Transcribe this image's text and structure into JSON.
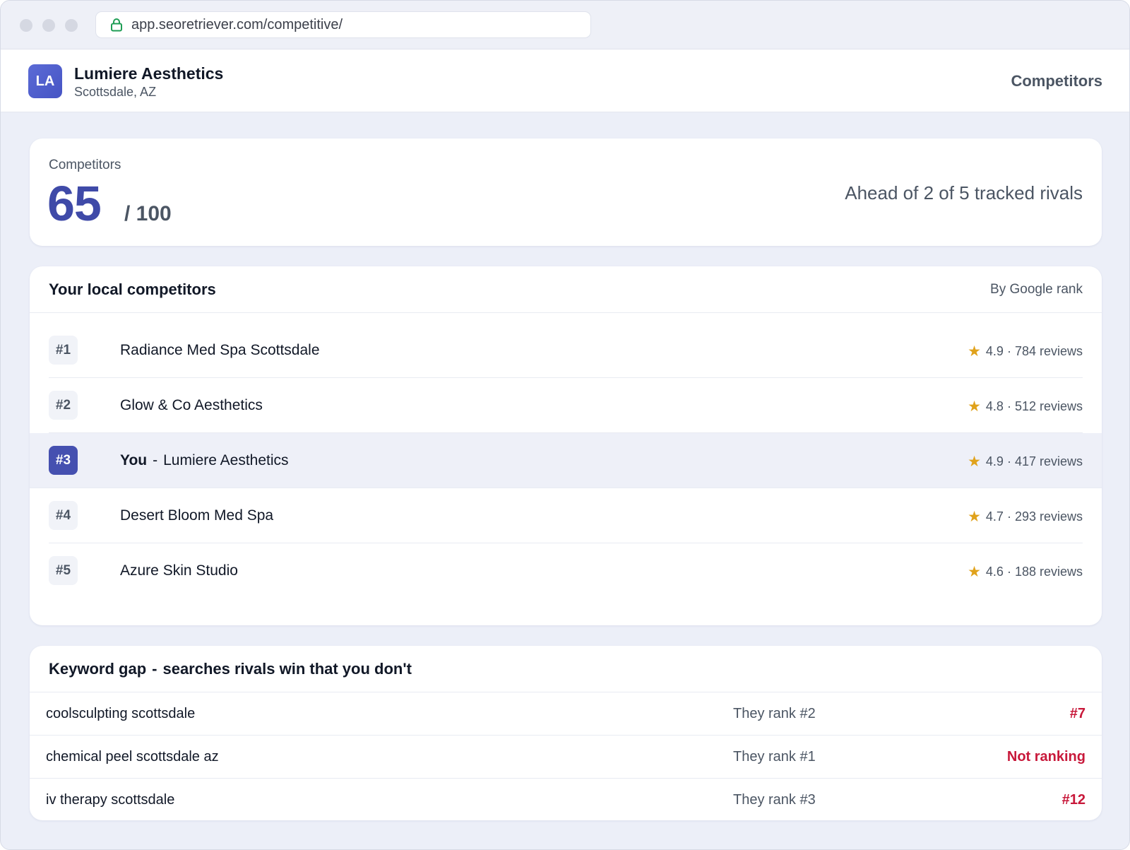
{
  "browser": {
    "url": "app.seoretriever.com/competitive/"
  },
  "header": {
    "logo_initials": "LA",
    "business_name": "Lumiere Aesthetics",
    "location": "Scottsdale, AZ",
    "nav_label": "Competitors"
  },
  "score": {
    "label": "Competitors",
    "value": "65",
    "max": "/ 100",
    "summary": "Ahead of 2 of 5 tracked rivals"
  },
  "competitors": {
    "title": "Your local competitors",
    "sort_label": "By Google rank",
    "items": [
      {
        "rank": "#1",
        "name": "Radiance Med Spa Scottsdale",
        "rating": "4.9 · 784 reviews"
      },
      {
        "rank": "#2",
        "name": "Glow & Co Aesthetics",
        "rating": "4.8 · 512 reviews"
      },
      {
        "rank": "#3",
        "you_label": "You",
        "separator": "-",
        "name": "Lumiere Aesthetics",
        "rating": "4.9 · 417 reviews"
      },
      {
        "rank": "#4",
        "name": "Desert Bloom Med Spa",
        "rating": "4.7 · 293 reviews"
      },
      {
        "rank": "#5",
        "name": "Azure Skin Studio",
        "rating": "4.6 · 188 reviews"
      }
    ]
  },
  "keyword_gap": {
    "title": "Keyword gap",
    "separator": "-",
    "subtitle": "searches rivals win that you don't",
    "rows": [
      {
        "term": "coolsculpting scottsdale",
        "their_rank": "They rank #2",
        "your_rank": "#7"
      },
      {
        "term": "chemical peel scottsdale az",
        "their_rank": "They rank #1",
        "your_rank": "Not ranking"
      },
      {
        "term": "iv therapy scottsdale",
        "their_rank": "They rank #3",
        "your_rank": "#12"
      }
    ]
  },
  "icons": {
    "lock": "lock-icon",
    "star": "star-icon"
  },
  "colors": {
    "accent": "#3f4aa8",
    "star": "#e0a21b",
    "negative": "#c8183a"
  }
}
